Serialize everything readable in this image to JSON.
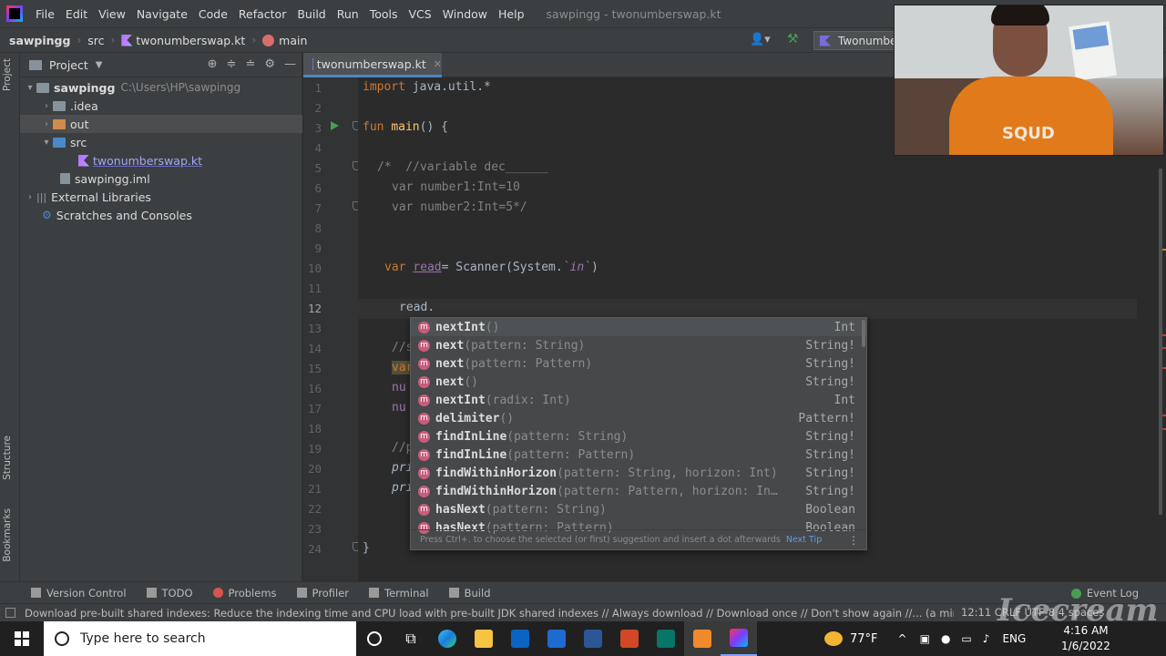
{
  "menubar": {
    "items": [
      "File",
      "Edit",
      "View",
      "Navigate",
      "Code",
      "Refactor",
      "Build",
      "Run",
      "Tools",
      "VCS",
      "Window",
      "Help"
    ],
    "window_title": "sawpingg - twonumberswap.kt"
  },
  "navbar": {
    "project": "sawpingg",
    "folder": "src",
    "file": "twonumberswap.kt",
    "function": "main",
    "run_config": "Twonumbe"
  },
  "left_stripe": {
    "project": "Project",
    "structure": "Structure",
    "bookmarks": "Bookmarks"
  },
  "project_panel": {
    "title": "Project",
    "tree": [
      {
        "label": "sawpingg",
        "extra": "C:\\Users\\HP\\sawpingg"
      },
      {
        "label": ".idea"
      },
      {
        "label": "out"
      },
      {
        "label": "src"
      },
      {
        "label": "twonumberswap.kt"
      },
      {
        "label": "sawpingg.iml"
      },
      {
        "label": "External Libraries"
      },
      {
        "label": "Scratches and Consoles"
      }
    ]
  },
  "editor": {
    "tab_label": "twonumberswap.kt",
    "current_line": "12",
    "line_numbers": [
      "1",
      "2",
      "3",
      "4",
      "5",
      "6",
      "7",
      "8",
      "9",
      "10",
      "11",
      "12",
      "13",
      "14",
      "15",
      "16",
      "17",
      "18",
      "19",
      "20",
      "21",
      "22",
      "23",
      "24"
    ],
    "code": {
      "l1_kw": "import",
      "l1_rest": " java.util.*",
      "l3_kw": "fun",
      "l3_fn": "main",
      "l3_rest": "() {",
      "l5": "/*  //variable dec______",
      "l6": "var number1:Int=10",
      "l7": "var number2:Int=5*/",
      "l10_kw": "var",
      "l10_var": "read",
      "l10_mid": "= Scanner(System.",
      "l10_it": "`in`",
      "l10_end": ")",
      "l12": "read.",
      "l14": "//s",
      "l15": "var",
      "l16": "nu",
      "l17": "nu",
      "l19": "//p",
      "l20": "pri",
      "l21": "pri",
      "l24": "}"
    }
  },
  "autocomplete": {
    "items": [
      {
        "name": "nextInt",
        "params": "()",
        "type": "Int"
      },
      {
        "name": "next",
        "params": "(pattern: String)",
        "type": "String!"
      },
      {
        "name": "next",
        "params": "(pattern: Pattern)",
        "type": "String!"
      },
      {
        "name": "next",
        "params": "()",
        "type": "String!"
      },
      {
        "name": "nextInt",
        "params": "(radix: Int)",
        "type": "Int"
      },
      {
        "name": "delimiter",
        "params": "()",
        "type": "Pattern!"
      },
      {
        "name": "findInLine",
        "params": "(pattern: String)",
        "type": "String!"
      },
      {
        "name": "findInLine",
        "params": "(pattern: Pattern)",
        "type": "String!"
      },
      {
        "name": "findWithinHorizon",
        "params": "(pattern: String, horizon: Int)",
        "type": "String!"
      },
      {
        "name": "findWithinHorizon",
        "params": "(pattern: Pattern, horizon: In…",
        "type": "String!"
      },
      {
        "name": "hasNext",
        "params": "(pattern: String)",
        "type": "Boolean"
      },
      {
        "name": "hasNext",
        "params": "(pattern: Pattern)",
        "type": "Boolean"
      }
    ],
    "footer": "Press Ctrl+. to choose the selected (or first) suggestion and insert a dot afterwards",
    "next_tip": "Next Tip"
  },
  "tool_windows": {
    "version_control": "Version Control",
    "todo": "TODO",
    "problems": "Problems",
    "profiler": "Profiler",
    "terminal": "Terminal",
    "build": "Build",
    "event_log": "Event Log"
  },
  "status_bar": {
    "message": "Download pre-built shared indexes: Reduce the indexing time and CPU load with pre-built JDK shared indexes // Always download // Download once // Don't show again //... (a minute ago)",
    "right": "12:11  CRLF  UTF-8  4 spaces"
  },
  "taskbar": {
    "search_placeholder": "Type here to search",
    "weather": "77°F",
    "language": "ENG",
    "time": "4:16 AM",
    "date": "1/6/2022"
  },
  "watermark": "Icecream"
}
